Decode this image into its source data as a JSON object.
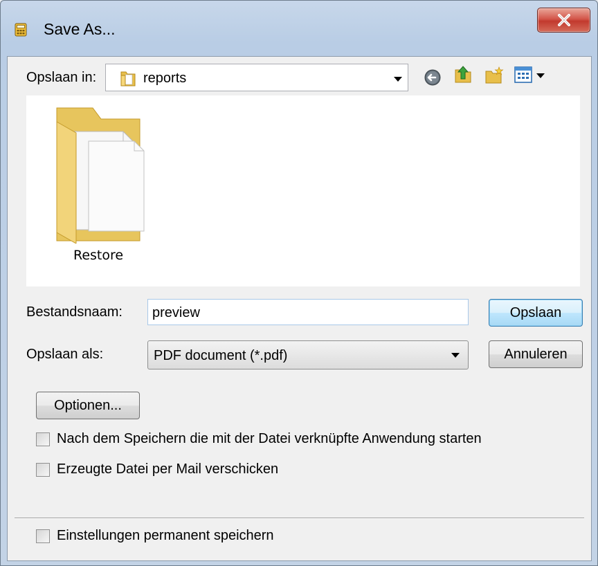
{
  "window": {
    "title": "Save As..."
  },
  "location": {
    "label": "Opslaan in:",
    "value": "reports"
  },
  "files": [
    {
      "name": "Restore"
    }
  ],
  "filename": {
    "label": "Bestandsnaam:",
    "value": "preview"
  },
  "filetype": {
    "label": "Opslaan als:",
    "value": "PDF document (*.pdf)"
  },
  "buttons": {
    "save": "Opslaan",
    "cancel": "Annuleren",
    "options": "Optionen..."
  },
  "checkboxes": [
    {
      "label": "Nach dem Speichern die mit der Datei verknüpfte Anwendung starten",
      "checked": false
    },
    {
      "label": "Erzeugte Datei per Mail verschicken",
      "checked": false
    },
    {
      "label": "Einstellungen permanent speichern",
      "checked": false
    }
  ],
  "toolbar_icons": [
    "back-icon",
    "up-folder-icon",
    "new-folder-icon",
    "view-menu-icon"
  ]
}
